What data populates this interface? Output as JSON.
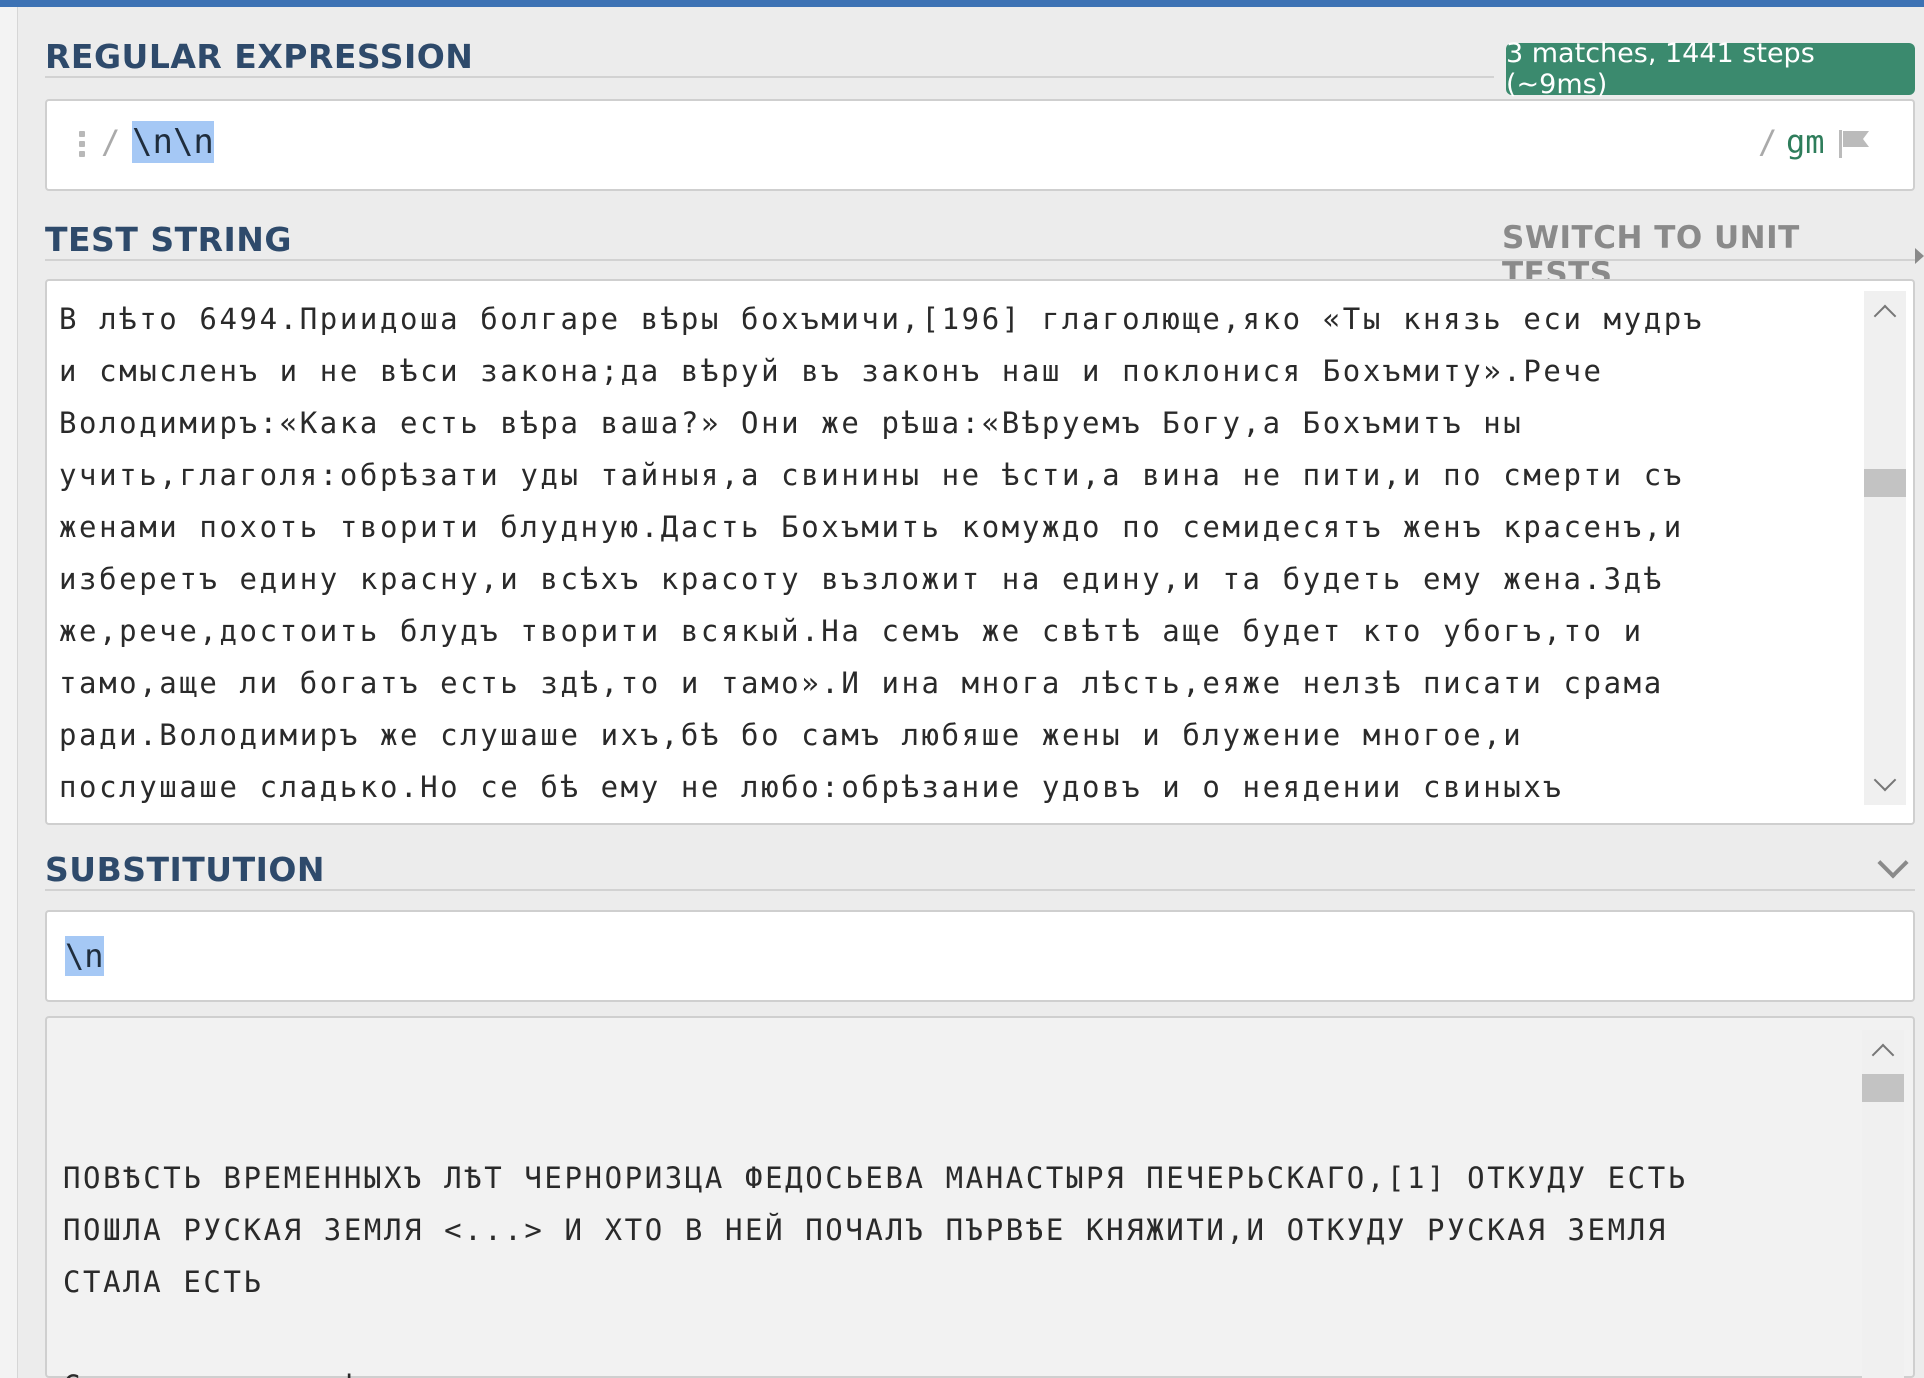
{
  "regex_section": {
    "title": "REGULAR EXPRESSION",
    "match_info": "3 matches, 1441 steps (~9ms)",
    "open_delimiter": "/",
    "pattern": "\\n\\n",
    "close_delimiter": "/",
    "flags": "gm"
  },
  "test_section": {
    "title": "TEST STRING",
    "switch_label": "SWITCH TO UNIT TESTS",
    "lines": [
      "В лѣто 6494.Приидоша болгаре вѣры бохъмичи,[196] глаголюще,яко «Ты князь еси мудръ",
      "и смысленъ и не вѣси закона;да вѣруй въ законъ наш и поклонися Бохъмиту».Рече",
      "Володимиръ:«Кака есть вѣра ваша?» Они же рѣша:«Вѣруемъ Богу,а Бохъмитъ ны",
      "учить,глаголя:обрѣзати уды тайныя,а свинины не ѣсти,а вина не пити,и по смерти съ",
      "женами похоть творити блудную.Дасть Бохъмить комуждо по семидесятъ женъ красенъ,и",
      "изберетъ едину красну,и всѣхъ красоту възложит на едину,и та будеть ему жена.Здѣ",
      "же,рече,достоить блудъ творити всякый.На семъ же свѣтѣ аще будет кто убогъ,то и",
      "тамо,аще ли богатъ есть здѣ,то и тамо».И ина многа лѣсть,еяже нелзѣ писати срама",
      "ради.Володимиръ же слушаше ихъ,бѣ бо самъ любяше жены и блужение многое,и",
      "послушаше сладько.Но се бѣ ему не любо:обрѣзание удовъ и о неядении свиныхъ"
    ]
  },
  "substitution_section": {
    "title": "SUBSTITUTION",
    "value": "\\n"
  },
  "result": {
    "lines": [
      "",
      "",
      "ПОВѢСТЬ ВРЕМЕННЫХЪ ЛѢТ ЧЕРНОРИЗЦА ФЕДОСЬЕВА МАНАСТЫРЯ ПЕЧЕРЬСКАГО,[1] ОТКУДУ ЕСТЬ",
      "ПОШЛА РУСКАЯ ЗЕМЛЯ <...> И ХТО В НЕЙ ПОЧАЛЪ ПЪРВѢЕ КНЯЖИТИ,И ОТКУДУ РУСКАЯ ЗЕМЛЯ",
      "СТАЛА ЕСТЬ",
      "",
      "Се начнемь повѣсть сию."
    ]
  },
  "icons": {
    "drag_handle": "drag-handle-icon",
    "flag": "flag-icon",
    "switch_caret": "caret-right-icon",
    "collapse": "chevron-down-icon",
    "scroll_up": "chevron-up-icon",
    "scroll_down": "chevron-down-icon"
  },
  "colors": {
    "accent_bar": "#3d72b4",
    "section_title": "#2e4a6b",
    "match_badge": "#3b8a6e",
    "selection": "#a5c8f5",
    "flags": "#2e7d5b"
  }
}
